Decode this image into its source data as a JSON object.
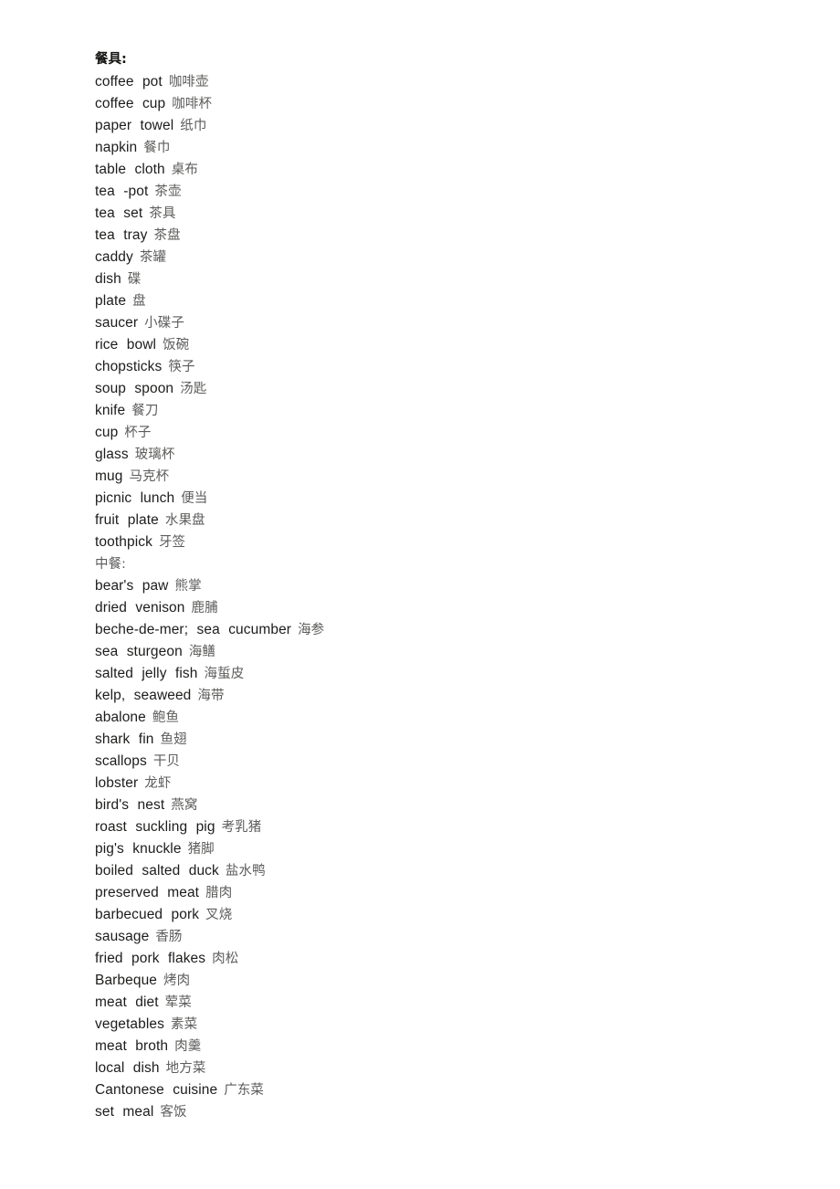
{
  "document": {
    "heading": "餐具:",
    "subsection_divider": "中餐:",
    "blocks": [
      {
        "kind": "heading",
        "label": "餐具:"
      },
      {
        "kind": "entries",
        "entries": [
          {
            "en": "coffee pot",
            "zh": "咖啡壶"
          },
          {
            "en": "coffee cup",
            "zh": "咖啡杯"
          },
          {
            "en": "paper towel",
            "zh": "纸巾"
          },
          {
            "en": "napkin",
            "zh": "餐巾"
          },
          {
            "en": "table cloth",
            "zh": "桌布"
          },
          {
            "en": "tea -pot",
            "zh": "茶壶"
          },
          {
            "en": "tea set",
            "zh": "茶具"
          },
          {
            "en": "tea tray",
            "zh": "茶盘"
          },
          {
            "en": "caddy",
            "zh": "茶罐"
          },
          {
            "en": "dish",
            "zh": "碟"
          },
          {
            "en": "plate",
            "zh": "盘"
          },
          {
            "en": "saucer",
            "zh": "小碟子"
          },
          {
            "en": "rice bowl",
            "zh": "饭碗"
          },
          {
            "en": "chopsticks",
            "zh": "筷子"
          },
          {
            "en": "soup spoon",
            "zh": "汤匙"
          },
          {
            "en": "knife",
            "zh": "餐刀"
          },
          {
            "en": "cup",
            "zh": "杯子"
          },
          {
            "en": "glass",
            "zh": "玻璃杯"
          },
          {
            "en": "mug",
            "zh": "马克杯"
          },
          {
            "en": "picnic lunch",
            "zh": "便当"
          },
          {
            "en": "fruit plate",
            "zh": "水果盘"
          },
          {
            "en": "toothpick",
            "zh": "牙签"
          }
        ]
      },
      {
        "kind": "divider",
        "label": "中餐:"
      },
      {
        "kind": "entries",
        "entries": [
          {
            "en": "bear's paw",
            "zh": "熊掌"
          },
          {
            "en": "dried venison",
            "zh": "鹿脯"
          },
          {
            "en": "beche-de-mer; sea cucumber",
            "zh": "海参"
          },
          {
            "en": "sea sturgeon",
            "zh": "海鳝"
          },
          {
            "en": "salted jelly fish",
            "zh": "海蜇皮"
          },
          {
            "en": "kelp, seaweed",
            "zh": "海带"
          },
          {
            "en": "abalone",
            "zh": "鲍鱼"
          },
          {
            "en": "shark fin",
            "zh": "鱼翅"
          },
          {
            "en": "scallops",
            "zh": "干贝"
          },
          {
            "en": "lobster",
            "zh": "龙虾"
          },
          {
            "en": "bird's nest",
            "zh": "燕窝"
          },
          {
            "en": "roast suckling pig",
            "zh": "考乳猪"
          },
          {
            "en": "pig's knuckle",
            "zh": "猪脚"
          },
          {
            "en": "boiled salted duck",
            "zh": "盐水鸭"
          },
          {
            "en": "preserved meat",
            "zh": "腊肉"
          },
          {
            "en": "barbecued pork",
            "zh": "叉烧"
          },
          {
            "en": "sausage",
            "zh": "香肠"
          },
          {
            "en": "fried pork flakes",
            "zh": "肉松"
          },
          {
            "en": "Barbeque",
            "zh": "烤肉"
          },
          {
            "en": "meat diet",
            "zh": "荤菜"
          },
          {
            "en": "vegetables",
            "zh": "素菜"
          },
          {
            "en": "meat broth",
            "zh": "肉羹"
          },
          {
            "en": "local dish",
            "zh": "地方菜"
          },
          {
            "en": "Cantonese cuisine",
            "zh": "广东菜"
          },
          {
            "en": "set meal",
            "zh": "客饭"
          }
        ]
      }
    ]
  }
}
